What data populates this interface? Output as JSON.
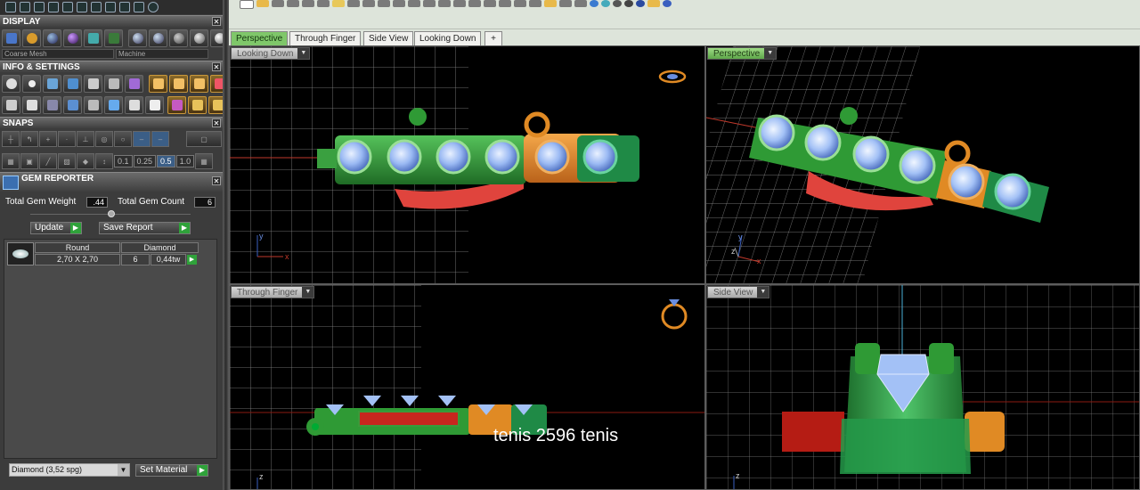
{
  "panel": {
    "display": {
      "title": "DISPLAY",
      "mesh_quality": "Coarse Mesh",
      "render_mode": "Machine"
    },
    "info_settings": {
      "title": "INFO & SETTINGS"
    },
    "snaps": {
      "title": "SNAPS",
      "values": [
        "0.1",
        "0.25",
        "0.5",
        "1.0"
      ],
      "active": "0.5"
    },
    "gem_reporter": {
      "title": "GEM REPORTER",
      "total_weight_label": "Total Gem Weight",
      "total_weight": ".44",
      "total_count_label": "Total Gem Count",
      "total_count": "6",
      "update_label": "Update",
      "save_report_label": "Save Report",
      "table": {
        "shape": "Round",
        "type": "Diamond",
        "size": "2,70 X 2,70",
        "count": "6",
        "weight": "0,44tw"
      },
      "material": "Diamond    (3,52 spg)",
      "set_material_label": "Set Material"
    }
  },
  "tabs": [
    {
      "label": "Perspective",
      "active": true
    },
    {
      "label": "Through Finger",
      "active": false
    },
    {
      "label": "Side View",
      "active": false
    },
    {
      "label": "Looking Down",
      "active": false
    }
  ],
  "viewports": {
    "top_left": "Looking Down",
    "top_right": "Perspective",
    "bottom_left": "Through Finger",
    "bottom_right": "Side View"
  },
  "axis": {
    "x": "x",
    "y": "y",
    "z": "z"
  },
  "overlay_text": "tenis  2596 tenis",
  "colors": {
    "accent_active_tab": "#7fc76a",
    "band_green": "#2f9a35",
    "band_orange": "#e08a24",
    "gem_blue": "#a9c8ff",
    "red_shank": "#e0443d",
    "grid": "#9a9a9a"
  }
}
